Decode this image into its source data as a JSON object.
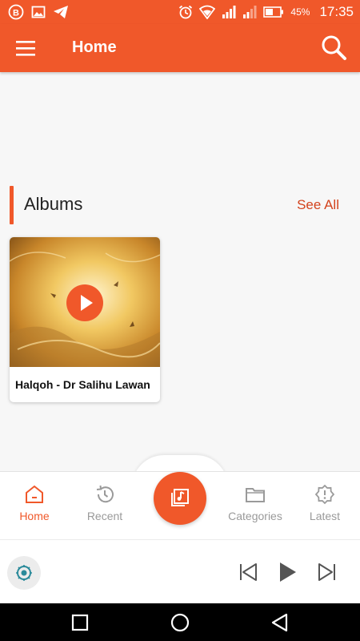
{
  "status_bar": {
    "battery": "45%",
    "time": "17:35",
    "left_icons": [
      "b-badge-icon",
      "image-icon",
      "telegram-icon"
    ],
    "right_icons": [
      "alarm-icon",
      "wifi-icon",
      "signal-icon",
      "signal-icon",
      "battery-icon"
    ]
  },
  "app_bar": {
    "title": "Home",
    "color": "#f0582a"
  },
  "albums_section": {
    "title": "Albums",
    "see_all": "See All",
    "items": [
      {
        "title": "Halqoh - Dr Salihu Lawan"
      }
    ]
  },
  "bottom_nav": {
    "items": [
      {
        "label": "Home",
        "icon": "home-icon",
        "active": true
      },
      {
        "label": "Recent",
        "icon": "history-icon",
        "active": false
      },
      {
        "label": "Categories",
        "icon": "folder-icon",
        "active": false
      },
      {
        "label": "Latest",
        "icon": "badge-alert-icon",
        "active": false
      }
    ],
    "center_button_icon": "music-library-icon"
  },
  "player": {
    "controls": [
      "skip-previous-icon",
      "play-icon",
      "skip-next-icon"
    ]
  },
  "system_nav": [
    "square-icon",
    "circle-icon",
    "triangle-back-icon"
  ]
}
